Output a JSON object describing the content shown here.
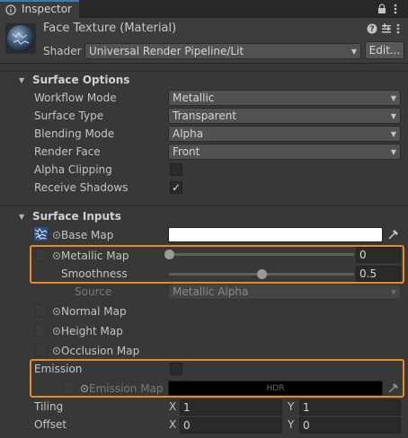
{
  "tab": {
    "title": "Inspector",
    "icon": "info-icon"
  },
  "header_icons": [
    "lock-icon",
    "menu-icon"
  ],
  "material": {
    "title": "Face Texture (Material)",
    "shader_label": "Shader",
    "shader_value": "Universal Render Pipeline/Lit",
    "edit_label": "Edit...",
    "icons": [
      "help-icon",
      "presets-icon",
      "more-icon"
    ]
  },
  "surface_options": {
    "title": "Surface Options",
    "workflow_mode": {
      "label": "Workflow Mode",
      "value": "Metallic"
    },
    "surface_type": {
      "label": "Surface Type",
      "value": "Transparent"
    },
    "blending_mode": {
      "label": "Blending Mode",
      "value": "Alpha"
    },
    "render_face": {
      "label": "Render Face",
      "value": "Front"
    },
    "alpha_clipping": {
      "label": "Alpha Clipping",
      "checked": false
    },
    "receive_shadows": {
      "label": "Receive Shadows",
      "checked": true
    }
  },
  "surface_inputs": {
    "title": "Surface Inputs",
    "base_map": {
      "label": "Base Map",
      "color": "#ffffff"
    },
    "metallic_map": {
      "label": "Metallic Map",
      "value": "0",
      "level": 0.0
    },
    "smoothness": {
      "label": "Smoothness",
      "value": "0.5",
      "level": 0.5
    },
    "source": {
      "label": "Source",
      "value": "Metallic Alpha"
    },
    "normal_map": {
      "label": "Normal Map"
    },
    "height_map": {
      "label": "Height Map"
    },
    "occlusion_map": {
      "label": "Occlusion Map"
    },
    "emission": {
      "label": "Emission",
      "checked": false
    },
    "emission_map": {
      "label": "Emission Map",
      "hdr": "HDR",
      "color": "#000000"
    },
    "tiling": {
      "label": "Tiling",
      "x_label": "X",
      "x": "1",
      "y_label": "Y",
      "y": "1"
    },
    "offset": {
      "label": "Offset",
      "x_label": "X",
      "x": "0",
      "y_label": "Y",
      "y": "0"
    }
  },
  "colors": {
    "accent_highlight": "#e8892a",
    "tab_accent": "#3a79bb"
  }
}
